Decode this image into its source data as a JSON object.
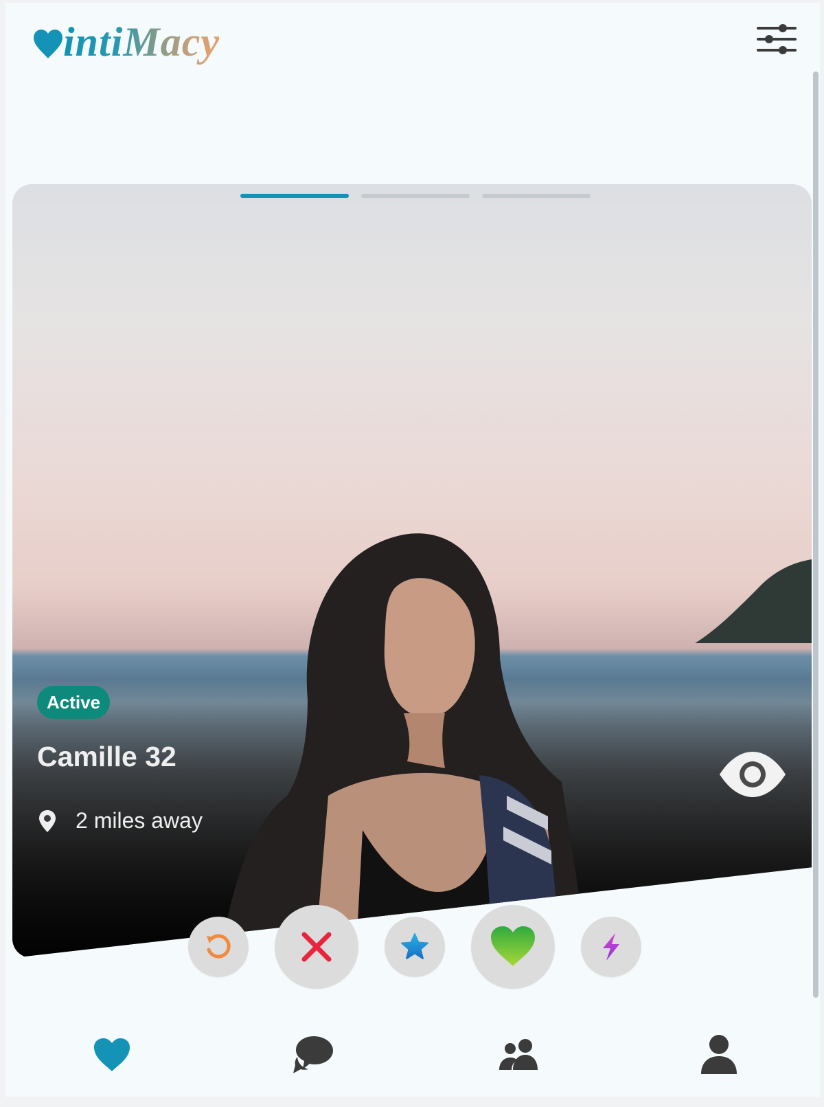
{
  "app": {
    "logo_text": "intiMacy",
    "brand_color": "#1493b6"
  },
  "header": {
    "filter_icon": "sliders-icon"
  },
  "card": {
    "photo_count": 3,
    "active_photo_index": 1,
    "status_badge": "Active",
    "status_color": "#0d8a7c",
    "name_age": "Camille 32",
    "distance": "2 miles away",
    "location_icon": "map-pin-icon",
    "view_profile_icon": "eye-icon"
  },
  "actions": [
    {
      "name": "rewind",
      "icon": "undo-icon",
      "color": "#f08a3c"
    },
    {
      "name": "nope",
      "icon": "close-icon",
      "color": "#e8253d"
    },
    {
      "name": "super-like",
      "icon": "star-icon",
      "color": "#1e8fd6"
    },
    {
      "name": "like",
      "icon": "heart-icon",
      "color": "#5cc53a"
    },
    {
      "name": "boost",
      "icon": "lightning-icon",
      "color": "#b23cd6"
    }
  ],
  "nav": [
    {
      "name": "discover",
      "icon": "heart-icon",
      "active": true
    },
    {
      "name": "messages",
      "icon": "chat-bubbles-icon",
      "active": false
    },
    {
      "name": "matches",
      "icon": "users-icon",
      "active": false
    },
    {
      "name": "profile",
      "icon": "user-icon",
      "active": false
    }
  ],
  "colors": {
    "nav_active": "#1493b6",
    "nav_inactive": "#3b3b3b",
    "action_bg": "#dcdcdc"
  }
}
